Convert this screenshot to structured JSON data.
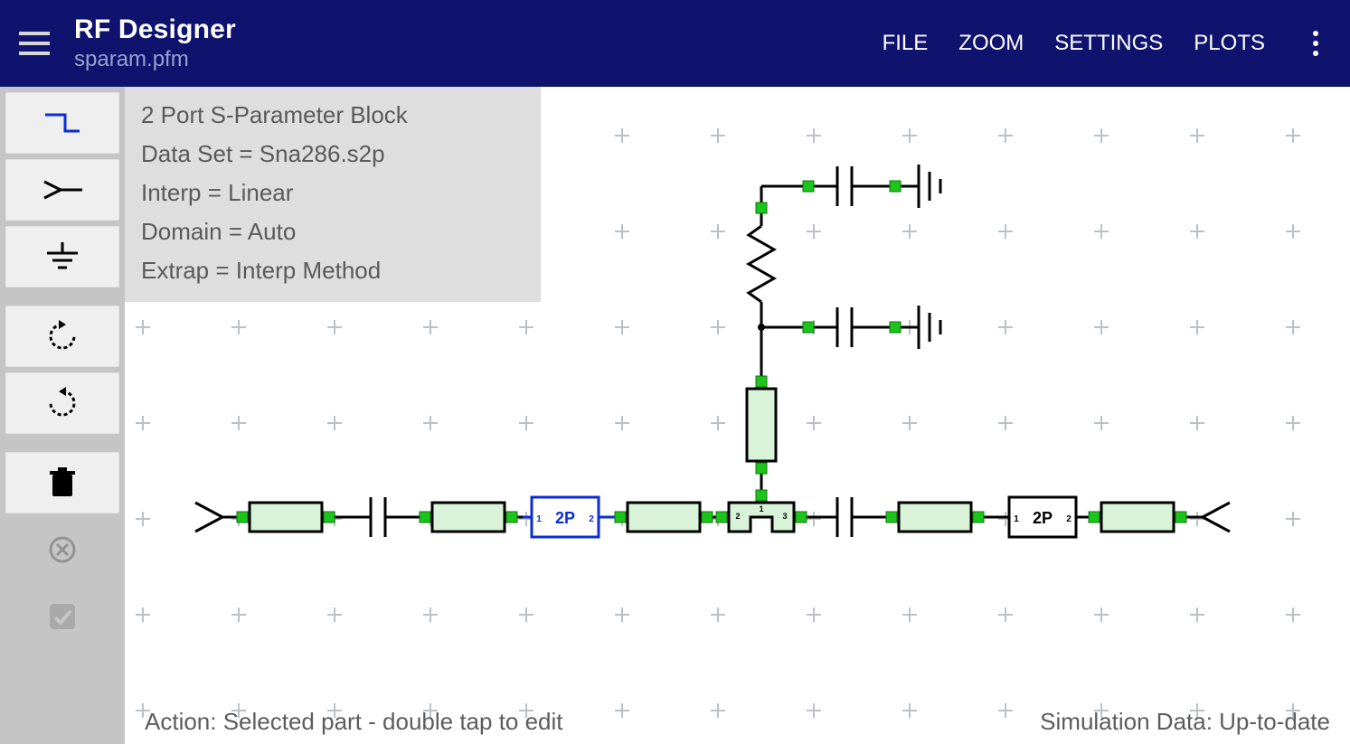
{
  "header": {
    "title": "RF Designer",
    "filename": "sparam.pfm",
    "menu": {
      "file": "FILE",
      "zoom": "ZOOM",
      "settings": "SETTINGS",
      "plots": "PLOTS"
    }
  },
  "info_panel": {
    "line1": "2 Port S-Parameter Block",
    "line2": "Data Set = Sna286.s2p",
    "line3": "Interp =  Linear",
    "line4": "Domain =  Auto",
    "line5": "Extrap =  Interp Method"
  },
  "schematic": {
    "selected_block_label": "2P",
    "second_block_label": "2P"
  },
  "status": {
    "action": "Action: Selected part - double tap to edit",
    "sim": "Simulation Data: Up-to-date"
  },
  "colors": {
    "header_bg": "#0f136e",
    "fill": "#d9f3d9",
    "node": "#1cc41c",
    "wire": "#000000",
    "selected": "#0b2dd6",
    "grid": "#9aa0a6"
  }
}
